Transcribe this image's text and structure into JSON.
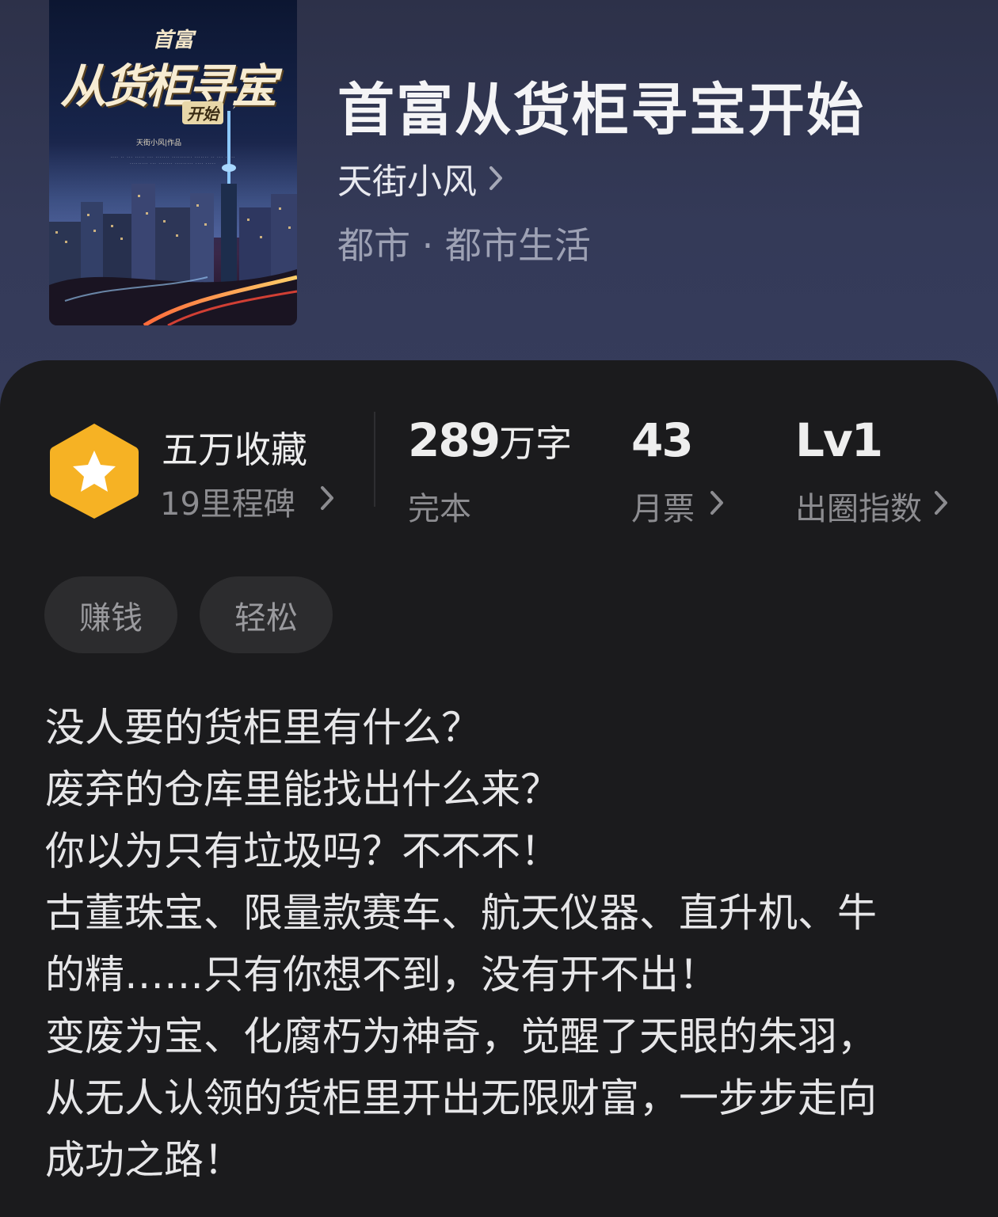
{
  "book": {
    "title": "首富从货柜寻宝开始",
    "author": "天街小风",
    "genre": "都市 · 都市生活"
  },
  "cover": {
    "title_top": "首富",
    "title_main": "从货柜寻宝",
    "title_badge": "开始",
    "author_line": "天街小风|作品",
    "tiny_line_1": "···· ·· ··· ····· ··· ······· ·········· ······· ·· ··· ·····",
    "tiny_line_2": "········· ··· ······· ········· ···· ·····"
  },
  "stats": {
    "collect": {
      "main": "五万收藏",
      "sub": "19里程碑"
    },
    "words": {
      "number": "289",
      "unit": "万字",
      "sub": "完本"
    },
    "tickets": {
      "number": "43",
      "sub": "月票"
    },
    "index": {
      "number": "Lv1",
      "sub": "出圈指数"
    }
  },
  "tags": [
    "赚钱",
    "轻松"
  ],
  "synopsis": [
    "没人要的货柜里有什么？",
    "废弃的仓库里能找出什么来？",
    "你以为只有垃圾吗？不不不！",
    "古董珠宝、限量款赛车、航天仪器、直升机、牛",
    "的精……只有你想不到，没有开不出！",
    "变废为宝、化腐朽为神奇，觉醒了天眼的朱羽，",
    "从无人认领的货柜里开出无限财富，一步步走向",
    "成功之路！"
  ],
  "colors": {
    "header_bg": "#343a58",
    "panel_bg": "#1b1b1d",
    "badge_orange": "#f6b224",
    "tag_bg": "#2c2c2e"
  },
  "icons": {
    "author_chevron": "chevron-right-icon",
    "badge": "star-hexagon-icon"
  }
}
